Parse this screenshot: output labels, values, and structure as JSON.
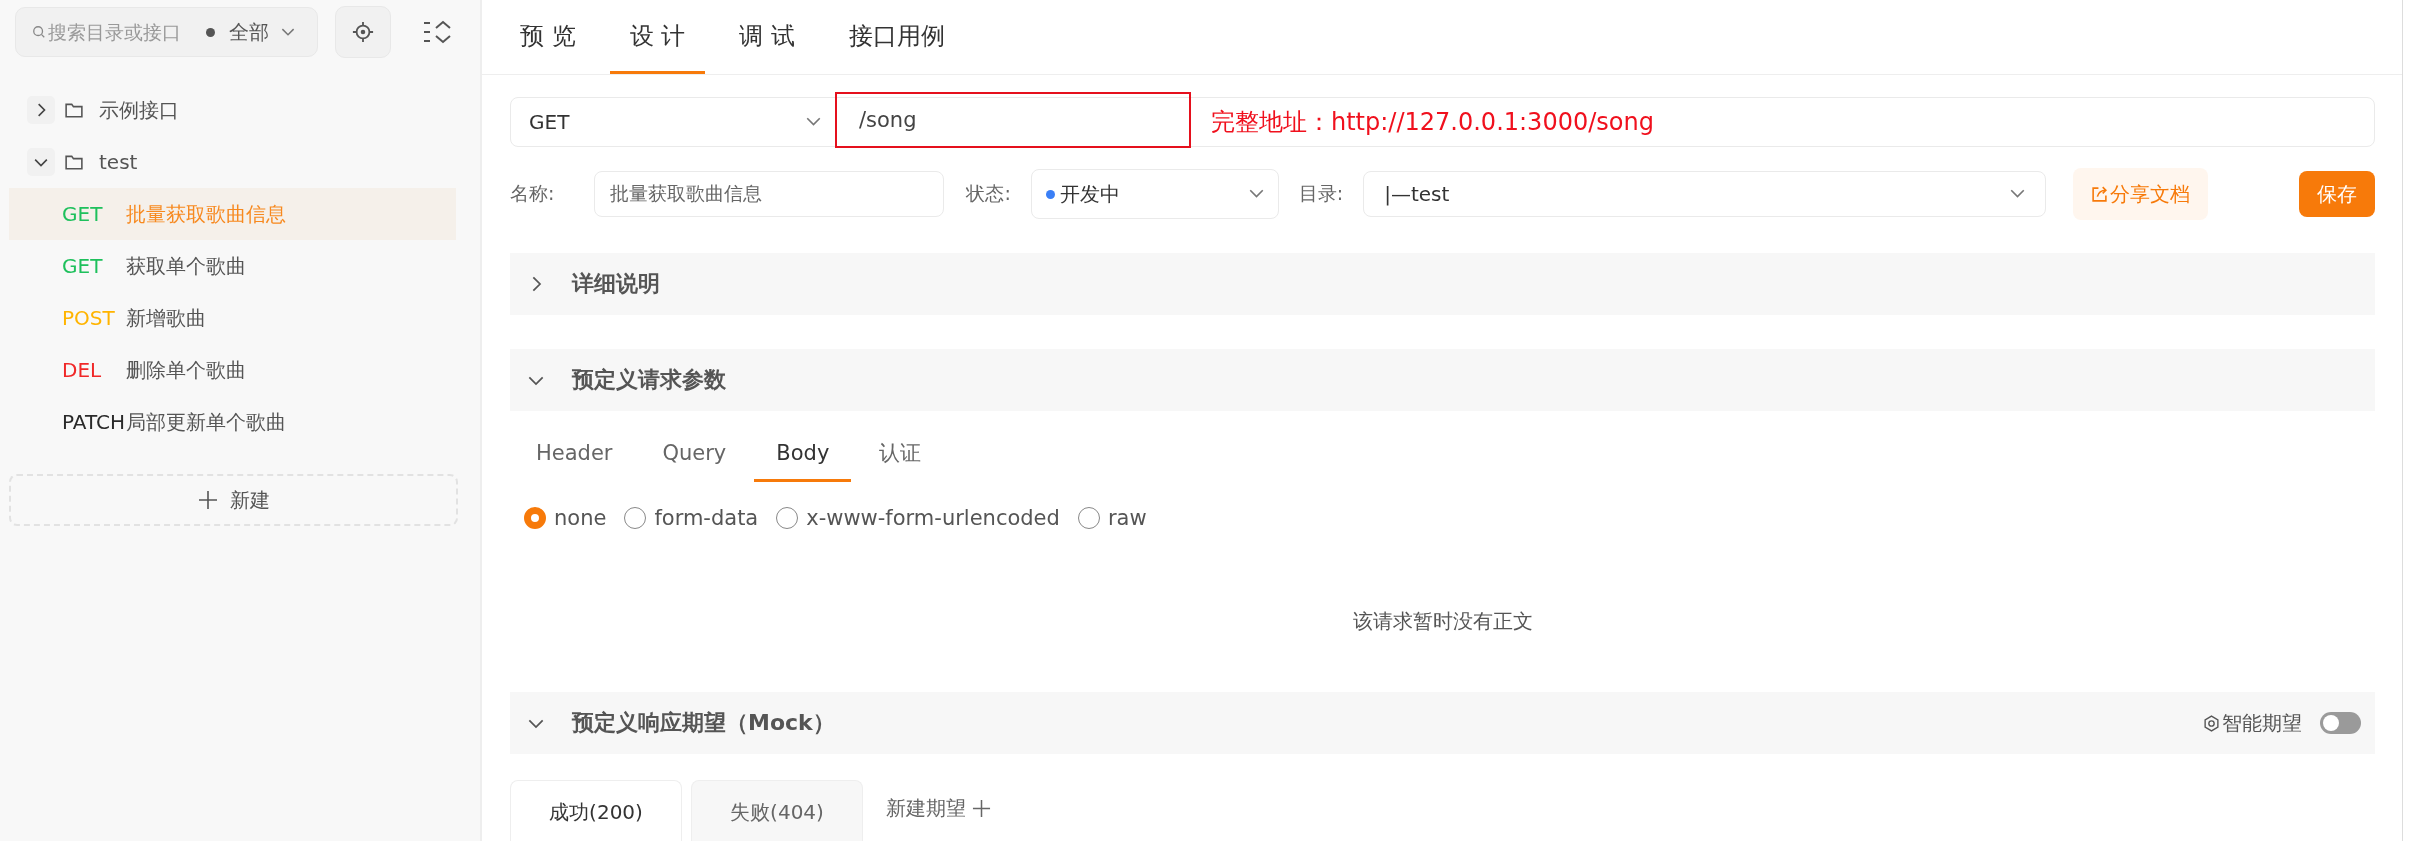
{
  "sidebar": {
    "search": {
      "placeholder": "搜索目录或接口"
    },
    "filter": "全部",
    "tree": [
      {
        "label": "示例接口",
        "expanded": false
      },
      {
        "label": "test",
        "expanded": true,
        "children": [
          {
            "method": "GET",
            "color": "#1ec05c",
            "label": "批量获取歌曲信息",
            "selected": true
          },
          {
            "method": "GET",
            "color": "#1ec05c",
            "label": "获取单个歌曲",
            "selected": false
          },
          {
            "method": "POST",
            "color": "#ffb400",
            "label": "新增歌曲",
            "selected": false
          },
          {
            "method": "DEL",
            "color": "#f02828",
            "label": "删除单个歌曲",
            "selected": false
          },
          {
            "method": "PATCH",
            "color": "#2a2a2a",
            "label": "局部更新单个歌曲",
            "selected": false
          }
        ]
      }
    ],
    "new_button": "新建"
  },
  "tabs": [
    {
      "label": "预 览",
      "selected": false
    },
    {
      "label": "设 计",
      "selected": true
    },
    {
      "label": "调 试",
      "selected": false
    },
    {
      "label": "接口用例",
      "selected": false
    }
  ],
  "request": {
    "method": "GET",
    "path": "/song",
    "highlighted": true,
    "annotation": "完整地址：http://127.0.0.1:3000/song"
  },
  "meta": {
    "name_label": "名称:",
    "name": "批量获取歌曲信息",
    "status_label": "状态:",
    "status": "开发中",
    "folder_label": "目录:",
    "folder": "|—test",
    "share_button": "分享文档",
    "save_button": "保存"
  },
  "sections": [
    {
      "title": "详细说明",
      "expanded": false
    },
    {
      "title": "预定义请求参数",
      "expanded": true
    }
  ],
  "params": {
    "tabs": [
      {
        "label": "Header",
        "selected": false
      },
      {
        "label": "Query",
        "selected": false
      },
      {
        "label": "Body",
        "selected": true
      },
      {
        "label": "认证",
        "selected": false
      }
    ],
    "body_types": [
      {
        "label": "none",
        "selected": true
      },
      {
        "label": "form-data",
        "selected": false
      },
      {
        "label": "x-www-form-urlencoded",
        "selected": false
      },
      {
        "label": "raw",
        "selected": false
      }
    ],
    "empty_text": "该请求暂时没有正文"
  },
  "mock": {
    "title": "预定义响应期望（Mock）",
    "expanded": true,
    "smart_label": "智能期望",
    "smart_on": false,
    "tabs": [
      {
        "label": "成功(200)",
        "selected": true
      },
      {
        "label": "失败(404)",
        "selected": false
      }
    ],
    "new_tab": "新建期望"
  }
}
